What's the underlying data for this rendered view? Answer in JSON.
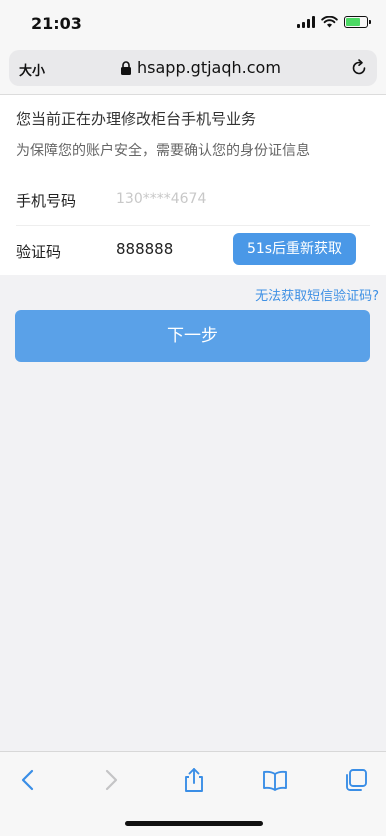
{
  "status_bar": {
    "time": "21:03"
  },
  "browser": {
    "text_size_label": "大小",
    "url": "hsapp.gtjaqh.com",
    "icons": [
      "lock-icon",
      "reload-icon"
    ]
  },
  "form": {
    "notice_line1": "您当前正在办理修改柜台手机号业务",
    "notice_line2": "为保障您的账户安全，需要确认您的身份证信息",
    "phone": {
      "label": "手机号码",
      "value": "130****4674"
    },
    "code": {
      "label": "验证码",
      "value": "888888"
    },
    "resend_button": "51s后重新获取"
  },
  "help_link": "无法获取短信验证码?",
  "next_button": "下一步",
  "toolbar": {
    "icons": [
      "back-icon",
      "forward-icon",
      "share-icon",
      "bookmarks-icon",
      "tabs-icon"
    ]
  },
  "colors": {
    "accent": "#4a98e7",
    "primary_button": "#5aa1e8",
    "link": "#3e90e4"
  }
}
